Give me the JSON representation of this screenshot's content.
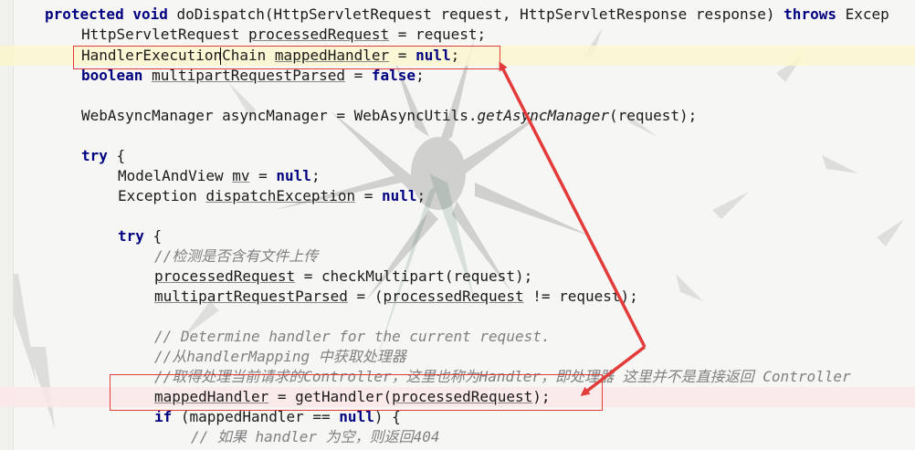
{
  "editor": {
    "lines": [
      {
        "id": "l1",
        "parts": [
          {
            "t": "protected void ",
            "c": "kw"
          },
          {
            "t": "doDispatch",
            "c": ""
          },
          {
            "t": "(HttpServletRequest request, HttpServletResponse response) ",
            "c": ""
          },
          {
            "t": "throws",
            "c": "kw"
          },
          {
            "t": " Excep",
            "c": ""
          }
        ]
      },
      {
        "id": "l2",
        "parts": [
          {
            "t": "HttpServletRequest ",
            "c": ""
          },
          {
            "t": "processedRequest",
            "c": "ul"
          },
          {
            "t": " = request;",
            "c": ""
          }
        ]
      },
      {
        "id": "l3",
        "parts": [
          {
            "t": "HandlerExecutionChain ",
            "c": ""
          },
          {
            "t": "mappedHandler",
            "c": "ul"
          },
          {
            "t": " = ",
            "c": ""
          },
          {
            "t": "null",
            "c": "kw"
          },
          {
            "t": ";",
            "c": ""
          }
        ]
      },
      {
        "id": "l4",
        "parts": [
          {
            "t": "boolean ",
            "c": "kw"
          },
          {
            "t": "multipartRequestParsed",
            "c": "ul"
          },
          {
            "t": " = ",
            "c": ""
          },
          {
            "t": "false",
            "c": "kw"
          },
          {
            "t": ";",
            "c": ""
          }
        ]
      },
      {
        "id": "l5",
        "parts": []
      },
      {
        "id": "l6",
        "parts": [
          {
            "t": "WebAsyncManager asyncManager = WebAsyncUtils.",
            "c": ""
          },
          {
            "t": "getAsyncManager",
            "c": "ital"
          },
          {
            "t": "(request);",
            "c": ""
          }
        ]
      },
      {
        "id": "l7",
        "parts": []
      },
      {
        "id": "l8",
        "parts": [
          {
            "t": "try",
            "c": "kw"
          },
          {
            "t": " {",
            "c": ""
          }
        ]
      },
      {
        "id": "l9",
        "parts": [
          {
            "t": "ModelAndView ",
            "c": ""
          },
          {
            "t": "mv",
            "c": "ul"
          },
          {
            "t": " = ",
            "c": ""
          },
          {
            "t": "null",
            "c": "kw"
          },
          {
            "t": ";",
            "c": ""
          }
        ]
      },
      {
        "id": "l10",
        "parts": [
          {
            "t": "Exception ",
            "c": ""
          },
          {
            "t": "dispatchException",
            "c": "ul"
          },
          {
            "t": " = ",
            "c": ""
          },
          {
            "t": "null",
            "c": "kw"
          },
          {
            "t": ";",
            "c": ""
          }
        ]
      },
      {
        "id": "l11",
        "parts": []
      },
      {
        "id": "l12",
        "parts": [
          {
            "t": "try",
            "c": "kw"
          },
          {
            "t": " {",
            "c": ""
          }
        ]
      },
      {
        "id": "l13",
        "parts": [
          {
            "t": "//检测是否含有文件上传",
            "c": "cm"
          }
        ]
      },
      {
        "id": "l14",
        "parts": [
          {
            "t": "processedRequest",
            "c": "ul"
          },
          {
            "t": " = checkMultipart(request);",
            "c": ""
          }
        ]
      },
      {
        "id": "l15",
        "parts": [
          {
            "t": "multipartRequestParsed",
            "c": "ul"
          },
          {
            "t": " = (",
            "c": ""
          },
          {
            "t": "processedRequest",
            "c": "ul"
          },
          {
            "t": " != request);",
            "c": ""
          }
        ]
      },
      {
        "id": "l16",
        "parts": []
      },
      {
        "id": "l17",
        "parts": [
          {
            "t": "// Determine handler for the current request.",
            "c": "cm"
          }
        ]
      },
      {
        "id": "l18",
        "parts": [
          {
            "t": "//从handlerMapping 中获取处理器",
            "c": "cm"
          }
        ]
      },
      {
        "id": "l19",
        "parts": [
          {
            "t": "//取得处理当前请求的Controller，这里也称为Handler，即处理器 这里并不是直接返回 Controller",
            "c": "cm"
          }
        ]
      },
      {
        "id": "l20",
        "parts": [
          {
            "t": "mappedHandler",
            "c": "ul"
          },
          {
            "t": " = getHandler(",
            "c": ""
          },
          {
            "t": "processedRequest",
            "c": "ul"
          },
          {
            "t": ");",
            "c": ""
          }
        ]
      },
      {
        "id": "l21",
        "parts": [
          {
            "t": "if",
            "c": "kw"
          },
          {
            "t": " (mappedHandler == ",
            "c": ""
          },
          {
            "t": "null",
            "c": "kw"
          },
          {
            "t": ") {",
            "c": ""
          }
        ]
      },
      {
        "id": "l22",
        "parts": [
          {
            "t": "// 如果 handler 为空，则返回404",
            "c": "cm"
          }
        ]
      }
    ]
  },
  "colors": {
    "keyword": "#000080",
    "comment": "#808080",
    "annotation": "#e33a3a",
    "highlight_line": "#fcf6cd",
    "error_line": "#fce8e8"
  }
}
